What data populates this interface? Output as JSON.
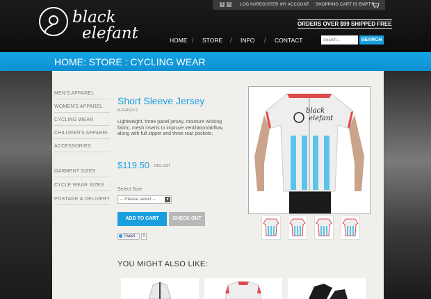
{
  "top_bar": {
    "facebook_icon": "f",
    "twitter_icon": "t",
    "login": "LOG IN/REGISTER",
    "account": "MY ACCOUNT",
    "cart_status": "SHOPPING CART IS EMPTY.",
    "cart_icon": "cart-icon"
  },
  "logo": {
    "line1": "black",
    "line2": "elefant"
  },
  "promo": "ORDERS OVER $99 SHIPPED FREE",
  "nav": {
    "home": "HOME",
    "store": "STORE",
    "info": "INFO",
    "contact": "CONTACT",
    "separator": "/"
  },
  "search": {
    "placeholder": "Search...",
    "button": "SEARCH"
  },
  "breadcrumb": "HOME: STORE : CYCLING WEAR",
  "sidebar": {
    "categories": [
      "MEN'S APPAREL",
      "WOMEN'S APPAREL",
      "CYCLING WEAR",
      "CHILDREN'S APPAREL",
      "ACCESSORIES"
    ],
    "info_links": [
      "GARMENT SIZES",
      "CYCLE WEAR SIZES",
      "POSTAGE & DELIVERY"
    ]
  },
  "product": {
    "title": "Short Sleeve Jersey",
    "sku": "M-JERSEY-1",
    "description": "Lightweight, three panel jersey, moisture wicking fabric, mesh inserts to improve ventilation/airflow, along with full zipper and three rear pockets.",
    "price": "$119.50",
    "price_note": "INCL GST",
    "size_label": "Select Size",
    "size_placeholder": "-- Please select --",
    "add_to_cart": "ADD TO CART",
    "checkout": "CHECK OUT",
    "tweet": "Tweet",
    "tweet_count": "0",
    "jersey_print_1": "black",
    "jersey_print_2": "elefant"
  },
  "also_like": "YOU MIGHT ALSO LIKE:",
  "colors": {
    "accent": "#1a9fde",
    "page_bg": "#f1efec",
    "header_bg": "#111111"
  }
}
